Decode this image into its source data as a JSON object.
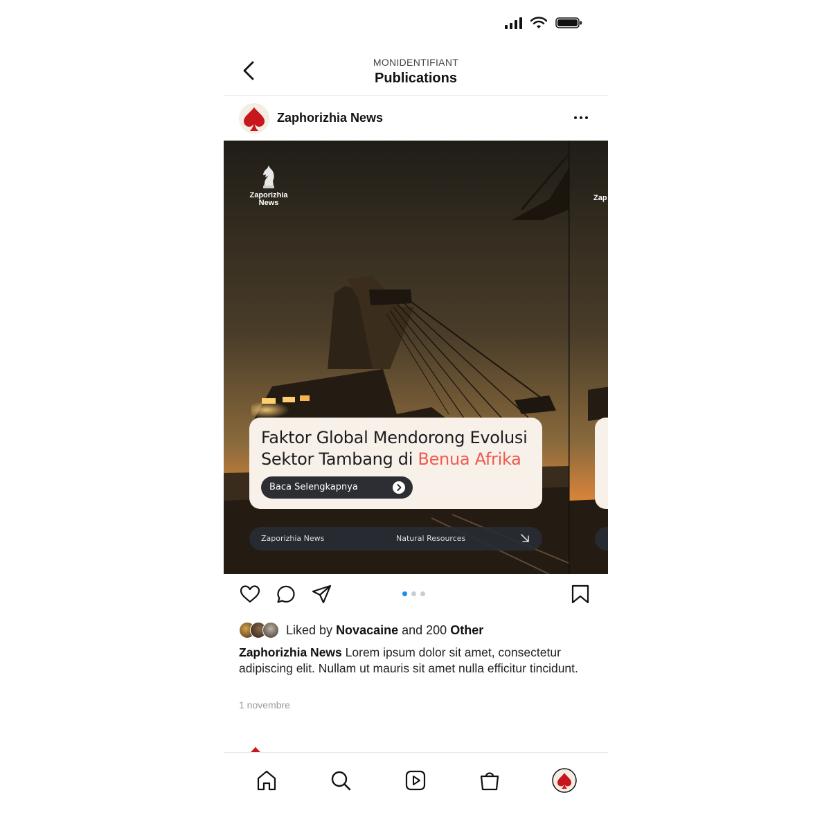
{
  "header": {
    "eyebrow": "MONIDENTIFIANT",
    "title": "Publications"
  },
  "post": {
    "account_name": "Zaphorizhia News",
    "slide": {
      "brand_line1": "Zaporizhia",
      "brand_line2": "News",
      "headline_part1": "Faktor Global Mendorong Evolusi Sektor Tambang di ",
      "headline_accent": "Benua Afrika",
      "cta_label": "Baca Selengkapnya",
      "footer_left": "Zaporizhia News",
      "footer_right": "Natural Resources",
      "next_brand": "Zap"
    },
    "carousel": {
      "count": 3,
      "active_index": 0
    },
    "likes": {
      "prefix": "Liked by",
      "user": "Novacaine",
      "middle": "and 200",
      "suffix": "Other"
    },
    "caption": {
      "author": "Zaphorizhia News",
      "text": "Lorem ipsum dolor sit amet, consectetur adipiscing elit. Nullam ut mauris sit amet nulla efficitur tincidunt."
    },
    "date": "1 novembre"
  },
  "icons": {
    "back": "chevron-left-icon",
    "more": "more-horizontal-icon",
    "like": "heart-icon",
    "comment": "comment-icon",
    "share": "send-icon",
    "save": "bookmark-icon",
    "nav": [
      "home-icon",
      "search-icon",
      "reels-icon",
      "shop-icon",
      "profile-avatar"
    ]
  },
  "colors": {
    "accent": "#ef5a4e",
    "brand_red": "#c8161d",
    "active_dot": "#1b8df0"
  }
}
